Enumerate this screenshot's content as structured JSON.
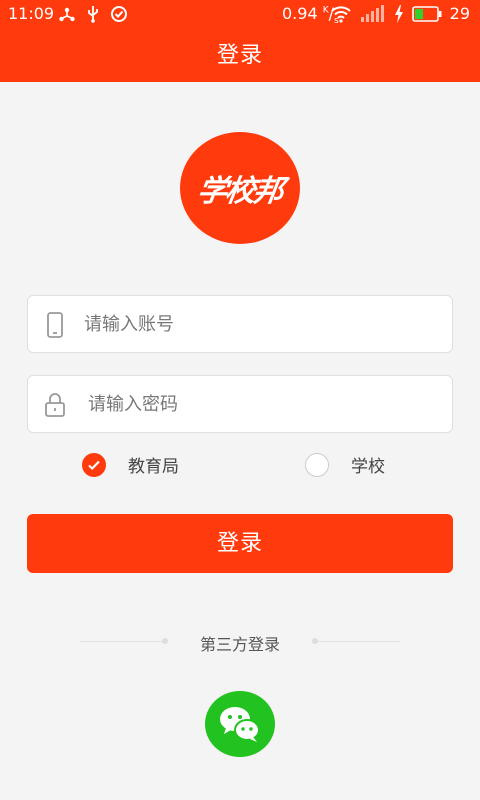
{
  "status_bar": {
    "time": "11:09",
    "icons_left": [
      "share-icon",
      "usb-icon",
      "check-circle-icon"
    ],
    "net_speed": "0.94",
    "net_speed_unit_top": "K",
    "net_speed_unit_bottom": "s",
    "battery_level": "29",
    "icons_right": [
      "wifi-icon",
      "signal-icon",
      "charging-icon",
      "battery-icon"
    ]
  },
  "header": {
    "title": "登录"
  },
  "logo": {
    "text": "学校邦"
  },
  "account": {
    "placeholder": "请输入账号",
    "value": ""
  },
  "password": {
    "placeholder": "请输入密码",
    "value": ""
  },
  "role": {
    "options": [
      {
        "label": "教育局",
        "checked": true
      },
      {
        "label": "学校",
        "checked": false
      }
    ]
  },
  "login_button": {
    "label": "登录"
  },
  "third_party": {
    "label": "第三方登录",
    "providers": [
      "wechat-icon"
    ]
  },
  "colors": {
    "brand": "#ff3a0c",
    "wechat": "#22c320",
    "background": "#f4f4f4"
  }
}
